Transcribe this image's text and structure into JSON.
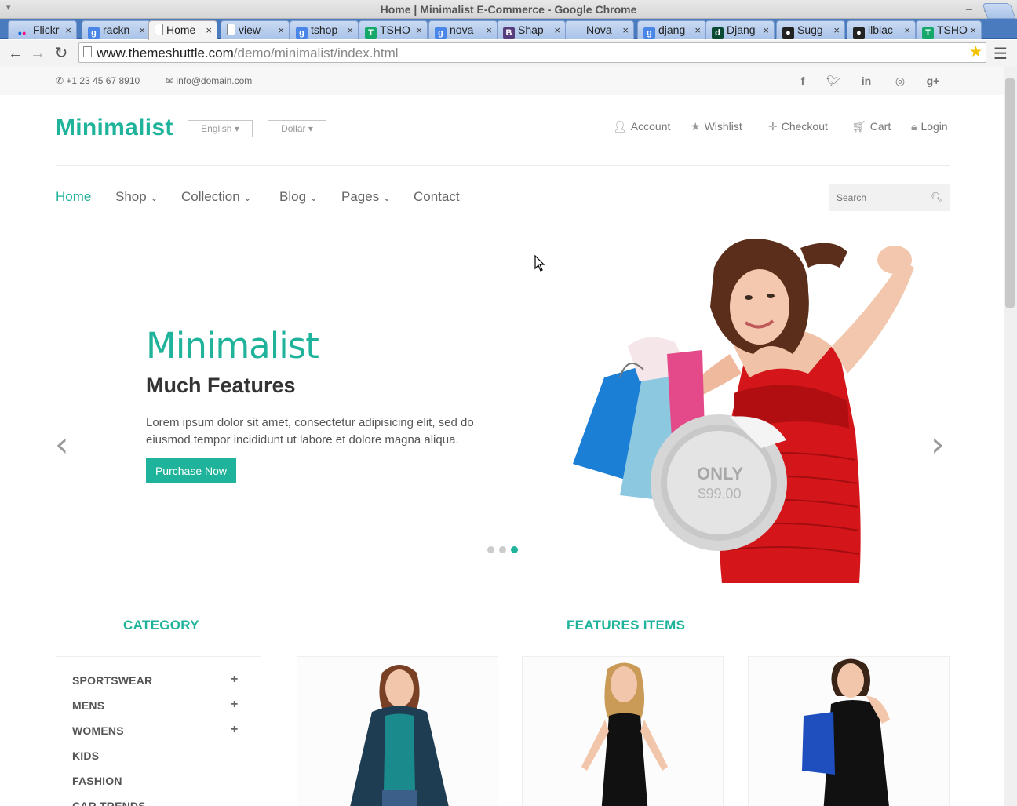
{
  "window": {
    "title": "Home | Minimalist E-Commerce - Google Chrome"
  },
  "tabs": [
    {
      "label": "Flickr",
      "icon": "flickr-icon",
      "color": "#0063dc"
    },
    {
      "label": "rackn",
      "icon": "google-icon",
      "color": "#4a86e8"
    },
    {
      "label": "Home",
      "icon": "page-icon",
      "active": true
    },
    {
      "label": "view-",
      "icon": "page-icon"
    },
    {
      "label": "tshop",
      "icon": "google-icon",
      "color": "#4a86e8"
    },
    {
      "label": "TSHO",
      "icon": "tshop-icon",
      "color": "#15a86a"
    },
    {
      "label": "nova",
      "icon": "google-icon",
      "color": "#4a86e8"
    },
    {
      "label": "Shap",
      "icon": "bootstrap-icon",
      "color": "#563d7c"
    },
    {
      "label": "Nova",
      "icon": "blank-icon"
    },
    {
      "label": "djang",
      "icon": "google-icon",
      "color": "#4a86e8"
    },
    {
      "label": "Djang",
      "icon": "django-icon",
      "color": "#0c4b33"
    },
    {
      "label": "Sugg",
      "icon": "github-icon",
      "color": "#222222"
    },
    {
      "label": "ilblac",
      "icon": "github-icon",
      "color": "#222222"
    },
    {
      "label": "TSHO",
      "icon": "tshop-icon",
      "color": "#15a86a"
    }
  ],
  "address": {
    "domain": "www.themeshuttle.com",
    "path": "/demo/minimalist/index.html"
  },
  "topbar": {
    "phone": "+1 23 45 67 8910",
    "email": "info@domain.com",
    "social": [
      "facebook-icon",
      "twitter-icon",
      "linkedin-icon",
      "dribbble-icon",
      "google-plus-icon"
    ]
  },
  "header": {
    "brand": "Minimalist",
    "language": "English",
    "currency": "Dollar",
    "links": [
      "Account",
      "Wishlist",
      "Checkout",
      "Cart",
      "Login"
    ]
  },
  "nav": {
    "items": [
      "Home",
      "Shop",
      "Collection",
      "Blog",
      "Pages",
      "Contact"
    ],
    "search_placeholder": "Search"
  },
  "hero": {
    "title": "Minimalist",
    "subtitle": "Much Features",
    "text": "Lorem ipsum dolor sit amet, consectetur adipisicing elit, sed do eiusmod tempor incididunt ut labore et dolore magna aliqua.",
    "button": "Purchase Now",
    "price_label": "ONLY",
    "price": "$99.00",
    "active_slide": 3,
    "slides": 3
  },
  "sections": {
    "category": "CATEGORY",
    "features": "FEATURES ITEMS"
  },
  "categories": [
    {
      "label": "SPORTSWEAR",
      "expandable": true
    },
    {
      "label": "MENS",
      "expandable": true
    },
    {
      "label": "WOMENS",
      "expandable": true
    },
    {
      "label": "KIDS",
      "expandable": false
    },
    {
      "label": "FASHION",
      "expandable": false
    },
    {
      "label": "CAR TRENDS",
      "expandable": false
    }
  ],
  "colors": {
    "accent": "#1eb39a",
    "text": "#333333",
    "muted": "#777777"
  }
}
